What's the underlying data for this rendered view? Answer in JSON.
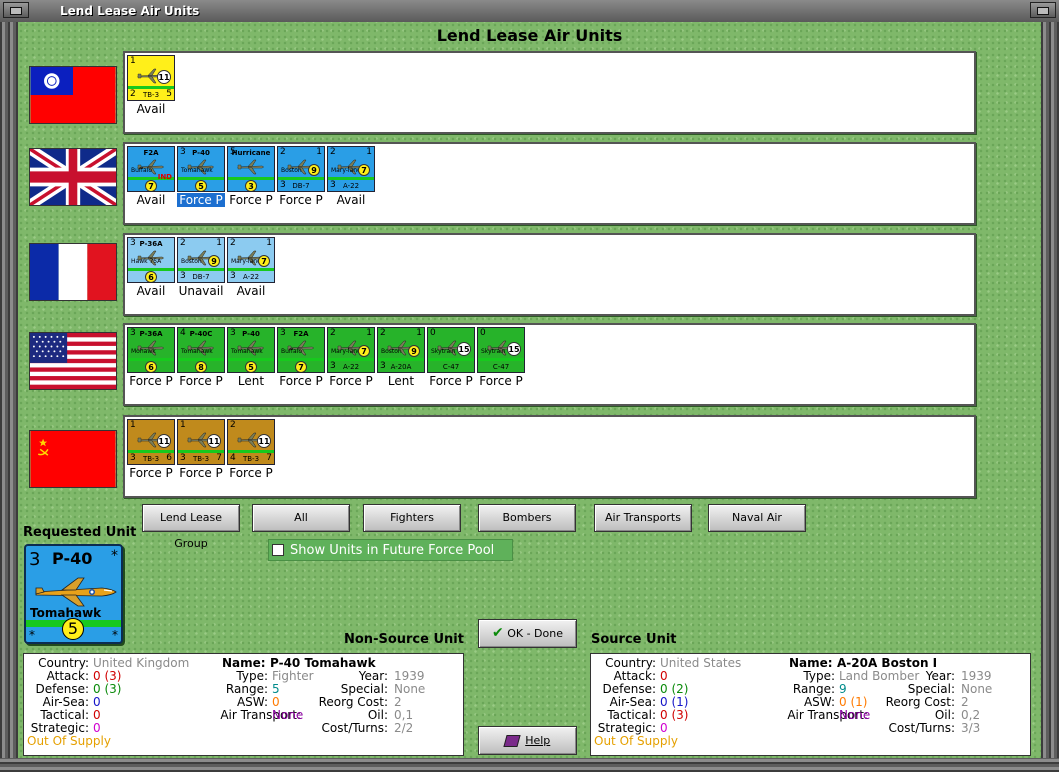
{
  "window": {
    "title": "Lend Lease Air Units"
  },
  "heading": "Lend Lease Air Units",
  "colors": {
    "china_counter": "#ffef1a",
    "uk_counter": "#2a9ee6",
    "france_counter": "#8ccbf0",
    "usa_counter": "#27b32a",
    "ussr_counter": "#c08a1c"
  },
  "rows": [
    {
      "country": "China",
      "flag_icon": "china-flag-icon",
      "units": [
        {
          "tl": "1",
          "tr": "",
          "top": "",
          "mid": "",
          "bl": "2",
          "bot": "TB-3",
          "br": "5",
          "dot": "11",
          "dot_style": "w",
          "status": "Avail"
        }
      ]
    },
    {
      "country": "United Kingdom",
      "flag_icon": "uk-flag-icon",
      "units": [
        {
          "tl": "",
          "tr": "",
          "top": "F2A",
          "mid": "Buffalo",
          "bl": "",
          "bot": "",
          "br": "",
          "dot": "7",
          "dot_style": "y",
          "ind": "IND",
          "status": "Avail"
        },
        {
          "tl": "3",
          "tr": "",
          "top": "P-40",
          "mid": "Tomahawk",
          "bl": "",
          "bot": "",
          "br": "",
          "dot": "5",
          "dot_style": "y",
          "status": "Force P",
          "selected": true
        },
        {
          "tl": "5",
          "tr": "",
          "top": "Hurricane",
          "mid": "",
          "bl": "",
          "bot": "",
          "br": "",
          "dot": "3",
          "dot_style": "y",
          "status": "Force P"
        },
        {
          "tl": "2",
          "tr": "1",
          "top": "",
          "mid": "Boston",
          "bl": "3",
          "bot": "DB-7",
          "br": "",
          "dot": "9",
          "dot_style": "yr",
          "status": "Force P"
        },
        {
          "tl": "2",
          "tr": "1",
          "top": "",
          "mid": "Mary-land",
          "bl": "3",
          "bot": "A-22",
          "br": "",
          "dot": "7",
          "dot_style": "yr",
          "status": "Avail"
        }
      ]
    },
    {
      "country": "France",
      "flag_icon": "france-flag-icon",
      "units": [
        {
          "tl": "3",
          "tr": "",
          "top": "P-36A",
          "mid": "Hawk 75A",
          "bl": "",
          "bot": "",
          "br": "",
          "dot": "6",
          "dot_style": "y",
          "status": "Avail"
        },
        {
          "tl": "2",
          "tr": "1",
          "top": "",
          "mid": "Boston",
          "bl": "3",
          "bot": "DB-7",
          "br": "",
          "dot": "9",
          "dot_style": "yr",
          "status": "Unavail"
        },
        {
          "tl": "2",
          "tr": "1",
          "top": "",
          "mid": "Mary-land",
          "bl": "3",
          "bot": "A-22",
          "br": "",
          "dot": "7",
          "dot_style": "yr",
          "status": "Avail"
        }
      ]
    },
    {
      "country": "United States",
      "flag_icon": "usa-flag-icon",
      "units": [
        {
          "tl": "3",
          "tr": "",
          "top": "P-36A",
          "mid": "Mohawk",
          "bl": "",
          "bot": "",
          "br": "",
          "dot": "6",
          "dot_style": "y",
          "status": "Force P"
        },
        {
          "tl": "4",
          "tr": "",
          "top": "P-40C",
          "mid": "Tomahawk",
          "bl": "",
          "bot": "",
          "br": "",
          "dot": "8",
          "dot_style": "y",
          "status": "Force P"
        },
        {
          "tl": "3",
          "tr": "",
          "top": "P-40",
          "mid": "Tomahawk",
          "bl": "",
          "bot": "",
          "br": "",
          "dot": "5",
          "dot_style": "y",
          "status": "Lent"
        },
        {
          "tl": "3",
          "tr": "",
          "top": "F2A",
          "mid": "Buffalo",
          "bl": "",
          "bot": "",
          "br": "",
          "dot": "7",
          "dot_style": "y",
          "status": "Force P"
        },
        {
          "tl": "2",
          "tr": "1",
          "top": "",
          "mid": "Mary-land",
          "bl": "3",
          "bot": "A-22",
          "br": "",
          "dot": "7",
          "dot_style": "yr",
          "status": "Force P"
        },
        {
          "tl": "2",
          "tr": "1",
          "top": "",
          "mid": "Boston",
          "bl": "3",
          "bot": "A-20A",
          "br": "",
          "dot": "9",
          "dot_style": "yr",
          "status": "Lent"
        },
        {
          "tl": "0",
          "tr": "",
          "top": "",
          "mid": "Skytrain",
          "bl": "",
          "bot": "C-47",
          "br": "",
          "dot": "15",
          "dot_style": "w",
          "status": "Force P"
        },
        {
          "tl": "0",
          "tr": "",
          "top": "",
          "mid": "Skytrain",
          "bl": "",
          "bot": "C-47",
          "br": "",
          "dot": "15",
          "dot_style": "w",
          "status": "Force P"
        }
      ]
    },
    {
      "country": "USSR",
      "flag_icon": "ussr-flag-icon",
      "units": [
        {
          "tl": "1",
          "tr": "",
          "top": "",
          "mid": "",
          "bl": "3",
          "bot": "TB-3",
          "br": "6",
          "dot": "11",
          "dot_style": "w",
          "status": "Force P"
        },
        {
          "tl": "1",
          "tr": "",
          "top": "",
          "mid": "",
          "bl": "3",
          "bot": "TB-3",
          "br": "7",
          "dot": "11",
          "dot_style": "w",
          "status": "Force P"
        },
        {
          "tl": "2",
          "tr": "",
          "top": "",
          "mid": "",
          "bl": "4",
          "bot": "TB-3",
          "br": "7",
          "dot": "11",
          "dot_style": "w",
          "status": "Force P"
        }
      ]
    }
  ],
  "buttons": {
    "lend_lease_group": "Lend Lease Group",
    "all": "All",
    "fighters": "Fighters",
    "bombers": "Bombers",
    "air_transports": "Air Transports",
    "naval_air": "Naval Air",
    "ok_done": "OK - Done",
    "help": "Help"
  },
  "future_force_pool": {
    "label": "Show Units in Future Force Pool",
    "checked": false
  },
  "requested_unit": {
    "title": "Requested Unit",
    "number": "3",
    "name": "P-40",
    "subname": "Tomahawk",
    "range": "5",
    "star": "*"
  },
  "non_source": {
    "title": "Non-Source Unit",
    "country_label": "Country:",
    "country": "United Kingdom",
    "name_label": "Name:",
    "name": "P-40 Tomahawk",
    "attack_label": "Attack:",
    "attack": "0",
    "attack_extra": "(3)",
    "type_label": "Type:",
    "type": "Fighter",
    "year_label": "Year:",
    "year": "1939",
    "defense_label": "Defense:",
    "defense": "0",
    "defense_extra": "(3)",
    "range_label": "Range:",
    "range": "5",
    "special_label": "Special:",
    "special": "None",
    "airsea_label": "Air-Sea:",
    "airsea": "0",
    "asw_label": "ASW:",
    "asw": "0",
    "reorg_label": "Reorg Cost:",
    "reorg": "2",
    "tactical_label": "Tactical:",
    "tactical": "0",
    "airtransport_label": "Air Transport:",
    "airtransport": "None",
    "oil_label": "Oil:",
    "oil": "0,1",
    "strategic_label": "Strategic:",
    "strategic": "0",
    "costturns_label": "Cost/Turns:",
    "costturns": "2/2",
    "supply": "Out Of Supply"
  },
  "source": {
    "title": "Source Unit",
    "country_label": "Country:",
    "country": "United States",
    "name_label": "Name:",
    "name": "A-20A Boston I",
    "attack_label": "Attack:",
    "attack": "0",
    "type_label": "Type:",
    "type": "Land Bomber",
    "year_label": "Year:",
    "year": "1939",
    "defense_label": "Defense:",
    "defense": "0",
    "defense_extra": "(2)",
    "range_label": "Range:",
    "range": "9",
    "special_label": "Special:",
    "special": "None",
    "airsea_label": "Air-Sea:",
    "airsea": "0",
    "airsea_extra": "(1)",
    "asw_label": "ASW:",
    "asw": "0",
    "asw_extra": "(1)",
    "reorg_label": "Reorg Cost:",
    "reorg": "2",
    "tactical_label": "Tactical:",
    "tactical": "0",
    "tactical_extra": "(3)",
    "airtransport_label": "Air Transport:",
    "airtransport": "None",
    "oil_label": "Oil:",
    "oil": "0,2",
    "strategic_label": "Strategic:",
    "strategic": "0",
    "costturns_label": "Cost/Turns:",
    "costturns": "3/3",
    "supply": "Out Of Supply"
  }
}
